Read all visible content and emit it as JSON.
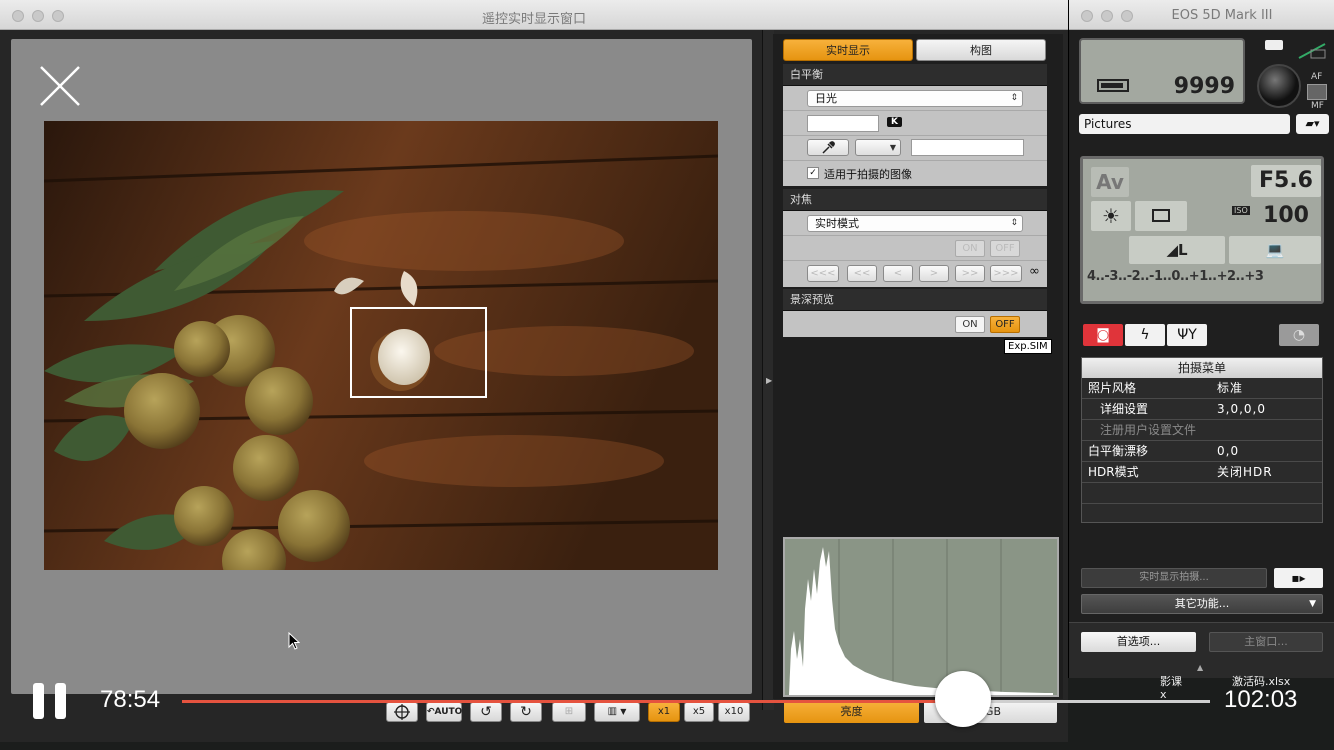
{
  "live_view": {
    "title": "遥控实时显示窗口",
    "tabs": {
      "live": "实时显示",
      "composition": "构图"
    },
    "white_balance": {
      "header": "白平衡",
      "mode": "日光",
      "k_label": "K",
      "apply_label": "适用于拍摄的图像",
      "apply_checked": "✓"
    },
    "focus": {
      "header": "对焦",
      "mode": "实时模式",
      "on": "ON",
      "off": "OFF",
      "steps": [
        "<<<",
        "<<",
        "<",
        ">",
        ">>",
        ">>>"
      ],
      "infinity": "∞"
    },
    "dof": {
      "header": "景深预览",
      "on": "ON",
      "off": "OFF"
    },
    "exp_sim": "Exp.SIM",
    "toolbar": {
      "auto": "AUTO",
      "zoom_x1": "x1",
      "zoom_x5": "x5",
      "zoom_x10": "x10"
    },
    "histogram_tabs": {
      "brightness": "亮度",
      "rgb": "RGB"
    }
  },
  "eos": {
    "title": "EOS 5D Mark III",
    "shots_remaining": "9999",
    "af_label": "AF",
    "mf_label": "MF",
    "folder": "Pictures",
    "mode": "Av",
    "aperture": "F5.6",
    "iso_label": "ISO",
    "iso": "100",
    "quality": "◢L",
    "exposure_scale": "4..-3..-2..-1..0..+1..+2..+3",
    "menu": {
      "title": "拍摄菜单",
      "rows": [
        {
          "key": "照片风格",
          "value": "标准"
        },
        {
          "key": "详细设置",
          "value": "3,0,0,0"
        },
        {
          "key": "注册用户设置文件",
          "value": ""
        },
        {
          "key": "白平衡漂移",
          "value": "0,0"
        },
        {
          "key": "HDR模式",
          "value": "关闭HDR"
        }
      ]
    },
    "lv_shoot_button": "实时显示拍摄...",
    "other_functions": "其它功能...",
    "preferences": "首选项...",
    "main_window": "主窗口..."
  },
  "desktop": {
    "file1": "激活码.xlsx",
    "file2": "影课",
    "file3": "x"
  },
  "player": {
    "current_time": "78:54",
    "total_time": "102:03",
    "progress": 0.76
  }
}
